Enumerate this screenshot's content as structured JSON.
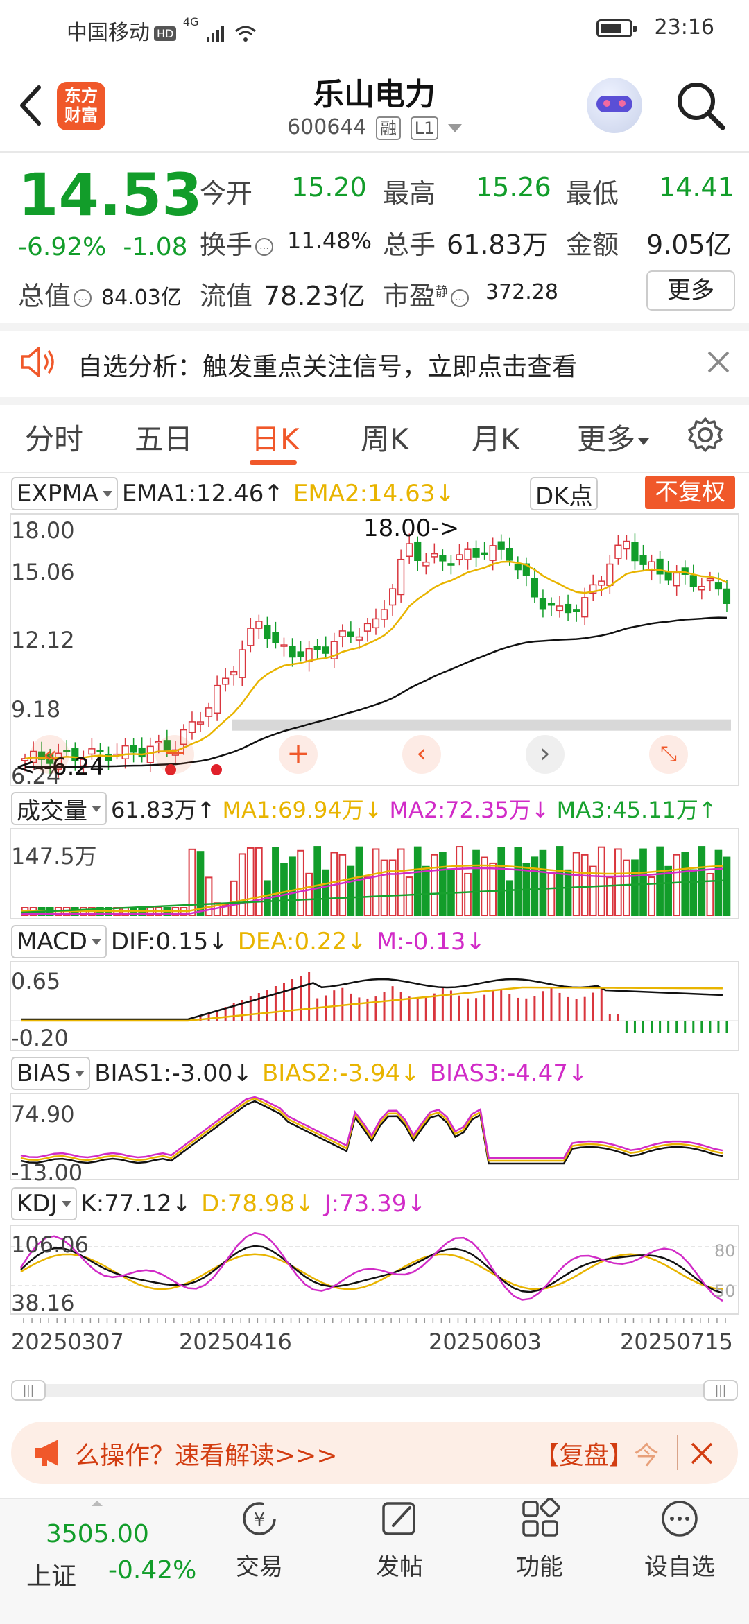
{
  "status": {
    "carrier": "中国移动",
    "hd": "HD",
    "net": "4G",
    "time": "23:16"
  },
  "header": {
    "logo_line1": "东方",
    "logo_line2": "财富",
    "title": "乐山电力",
    "code": "600644",
    "tag1": "融",
    "tag2": "L1"
  },
  "quote": {
    "price": "14.53",
    "chg_pct": "-6.92%",
    "chg": "-1.08",
    "open_label": "今开",
    "open": "15.20",
    "high_label": "最高",
    "high": "15.26",
    "low_label": "最低",
    "low": "14.41",
    "turnover_label": "换手",
    "turnover": "11.48%",
    "volume_label": "总手",
    "volume": "61.83万",
    "amount_label": "金额",
    "amount": "9.05亿",
    "mcap_label": "总值",
    "mcap": "84.03亿",
    "float_label": "流值",
    "float": "78.23亿",
    "pe_label": "市盈",
    "pe_sup": "静",
    "pe": "372.28",
    "more": "更多"
  },
  "notice": {
    "label": "自选分析：",
    "text": "触发重点关注信号，立即点击查看"
  },
  "tabs": [
    "分时",
    "五日",
    "日K",
    "周K",
    "月K",
    "更多"
  ],
  "main_chart": {
    "indicator": "EXPMA",
    "ema1": "EMA1:12.46↑",
    "ema2": "EMA2:14.63↓",
    "dk_btn": "DK点",
    "fq_btn": "不复权",
    "y_labels": [
      "18.00",
      "15.06",
      "12.12",
      "9.18",
      "6.24"
    ],
    "max_label": "18.00->",
    "min_label": "<--6.24"
  },
  "volume_panel": {
    "indicator": "成交量",
    "vol": "61.83万↑",
    "ma1": "MA1:69.94万↓",
    "ma2": "MA2:72.35万↓",
    "ma3": "MA3:45.11万↑",
    "y_max": "147.5万"
  },
  "macd_panel": {
    "indicator": "MACD",
    "dif": "DIF:0.15↓",
    "dea": "DEA:0.22↓",
    "m": "M:-0.13↓",
    "y_top": "0.65",
    "y_bot": "-0.20"
  },
  "bias_panel": {
    "indicator": "BIAS",
    "b1": "BIAS1:-3.00↓",
    "b2": "BIAS2:-3.94↓",
    "b3": "BIAS3:-4.47↓",
    "y_top": "74.90",
    "y_bot": "-13.00"
  },
  "kdj_panel": {
    "indicator": "KDJ",
    "k": "K:77.12↓",
    "d": "D:78.98↓",
    "j": "J:73.39↓",
    "y_top": "106.06",
    "y_bot": "38.16",
    "ref80": "80",
    "ref50": "50"
  },
  "dates": [
    "20250307",
    "20250416",
    "20250603",
    "20250715"
  ],
  "banner": {
    "text_a": "么操作？",
    "text_b": "速看解读>>>",
    "text_c": "【复盘】",
    "text_d": "今"
  },
  "bottom_nav": {
    "index_value": "3505.00",
    "index_name": "上证",
    "index_chg": "-0.42%",
    "items": [
      "交易",
      "发帖",
      "功能",
      "设自选"
    ]
  },
  "colors": {
    "up": "#d9363e",
    "down": "#129d2a",
    "accent": "#f0582a"
  }
}
